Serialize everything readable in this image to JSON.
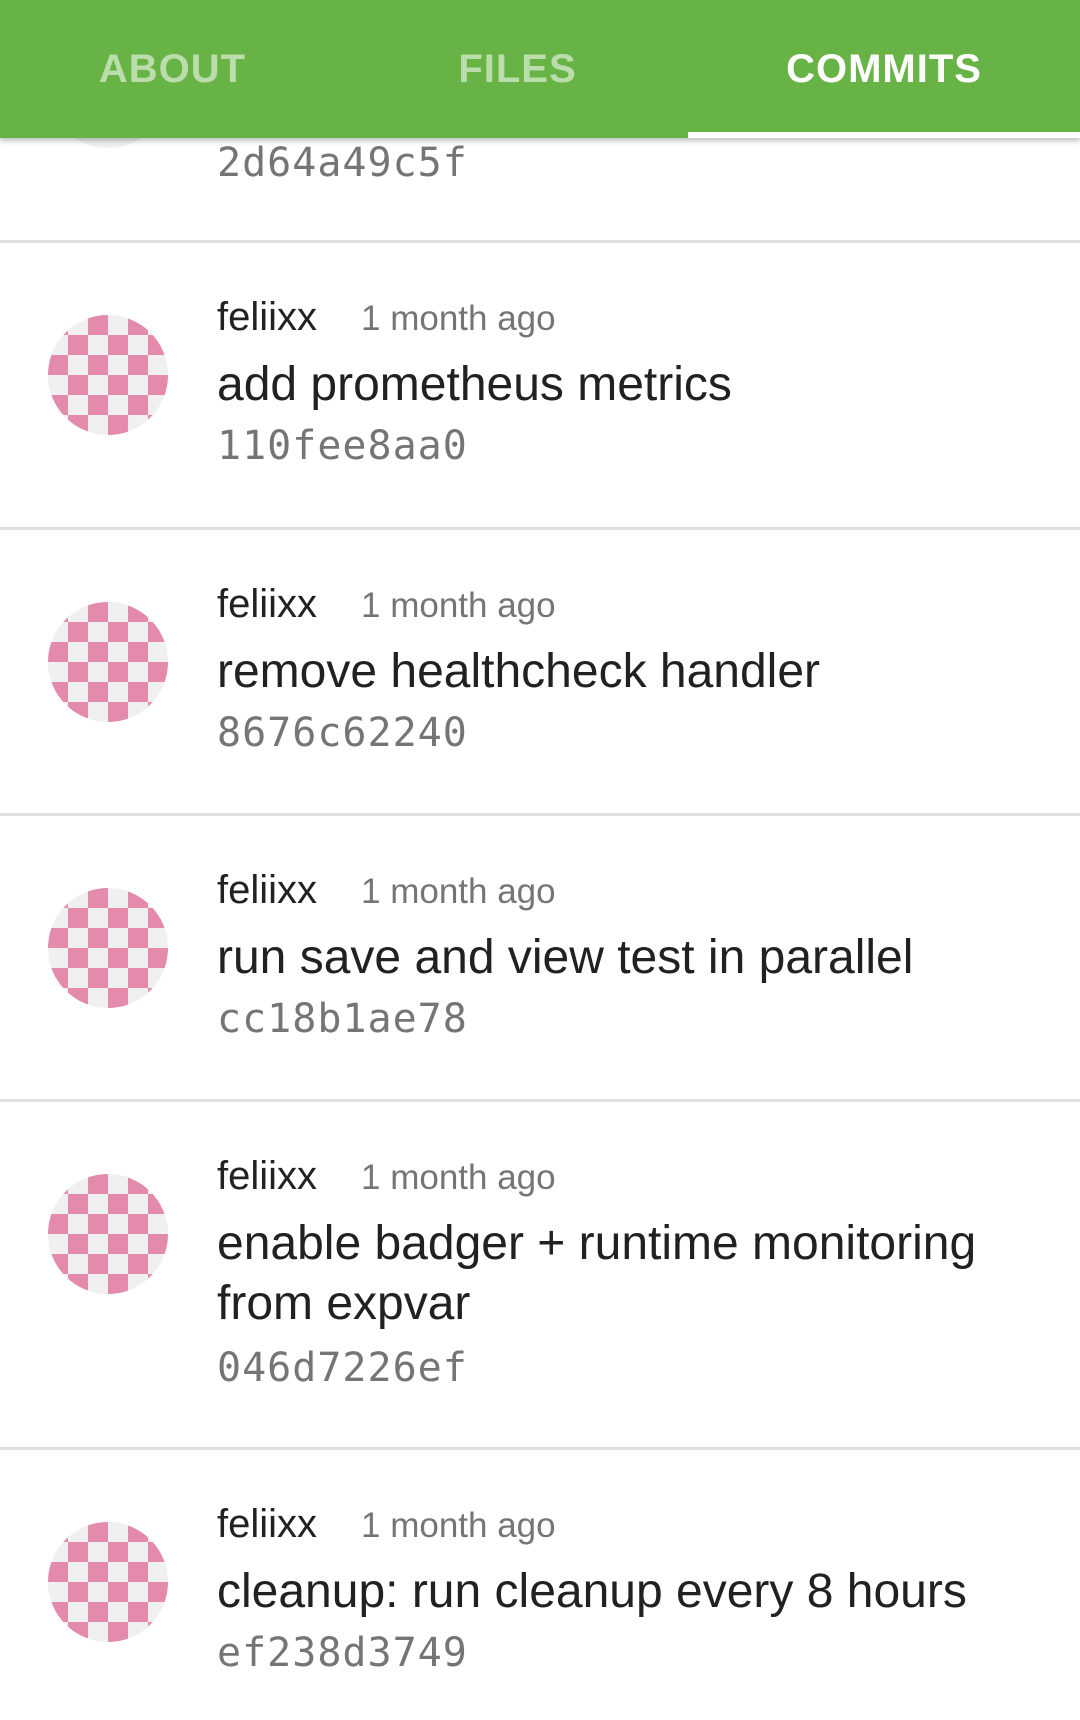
{
  "tabs": [
    {
      "label": "ABOUT",
      "active": false
    },
    {
      "label": "FILES",
      "active": false
    },
    {
      "label": "COMMITS",
      "active": true
    }
  ],
  "colors": {
    "toolbar": "#67b346",
    "avatar_pattern": "#e48aac",
    "avatar_background": "#f0f0f0"
  },
  "commits": [
    {
      "author": "",
      "time": "",
      "message": "",
      "sha": "2d64a49c5f"
    },
    {
      "author": "feliixx",
      "time": "1 month ago",
      "message": "add prometheus metrics",
      "sha": "110fee8aa0"
    },
    {
      "author": "feliixx",
      "time": "1 month ago",
      "message": "remove healthcheck handler",
      "sha": "8676c62240"
    },
    {
      "author": "feliixx",
      "time": "1 month ago",
      "message": "run save and view test in parallel",
      "sha": "cc18b1ae78"
    },
    {
      "author": "feliixx",
      "time": "1 month ago",
      "message": "enable badger + runtime monitoring from expvar",
      "sha": "046d7226ef"
    },
    {
      "author": "feliixx",
      "time": "1 month ago",
      "message": "cleanup: run cleanup every 8 hours",
      "sha": "ef238d3749"
    }
  ]
}
